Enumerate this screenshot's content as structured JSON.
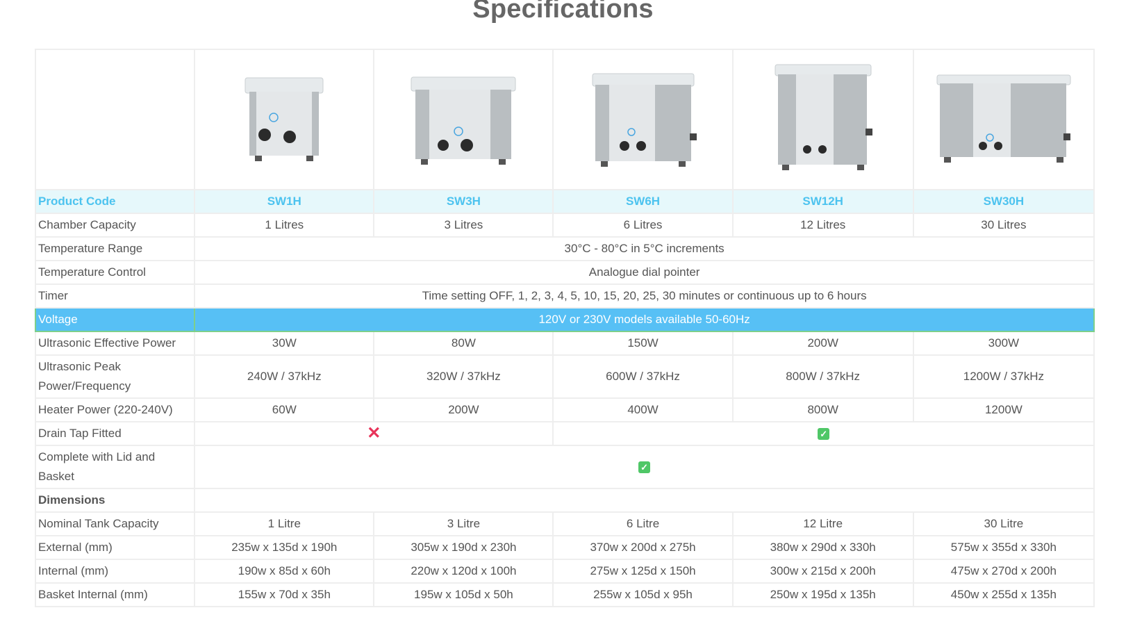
{
  "title": "Specifications",
  "products": [
    {
      "code": "SW1H",
      "capacity": "1 Litres",
      "effective_power": "30W",
      "peak_power": "240W / 37kHz",
      "heater_power": "60W",
      "nominal": "1 Litre",
      "external": "235w x 135d x 190h",
      "internal": "190w x 85d x 60h",
      "basket": "155w x 70d x 35h"
    },
    {
      "code": "SW3H",
      "capacity": "3 Litres",
      "effective_power": "80W",
      "peak_power": "320W / 37kHz",
      "heater_power": "200W",
      "nominal": "3 Litre",
      "external": "305w x 190d x 230h",
      "internal": "220w x 120d x 100h",
      "basket": "195w x 105d x 50h"
    },
    {
      "code": "SW6H",
      "capacity": "6 Litres",
      "effective_power": "150W",
      "peak_power": "600W / 37kHz",
      "heater_power": "400W",
      "nominal": "6 Litre",
      "external": "370w x 200d x 275h",
      "internal": "275w x 125d x 150h",
      "basket": "255w x 105d x 95h"
    },
    {
      "code": "SW12H",
      "capacity": "12 Litres",
      "effective_power": "200W",
      "peak_power": "800W / 37kHz",
      "heater_power": "800W",
      "nominal": "12 Litre",
      "external": "380w x 290d x 330h",
      "internal": "300w x 215d x 200h",
      "basket": "250w x 195d x 135h"
    },
    {
      "code": "SW30H",
      "capacity": "30 Litres",
      "effective_power": "300W",
      "peak_power": "1200W / 37kHz",
      "heater_power": "1200W",
      "nominal": "30 Litre",
      "external": "575w x 355d x 330h",
      "internal": "475w x 270d x 200h",
      "basket": "450w x 255d x 135h"
    }
  ],
  "labels": {
    "product_code": "Product Code",
    "chamber_capacity": "Chamber Capacity",
    "temperature_range": "Temperature Range",
    "temperature_control": "Temperature Control",
    "timer": "Timer",
    "voltage": "Voltage",
    "effective_power": "Ultrasonic Effective Power",
    "peak_power": "Ultrasonic Peak Power/Frequency",
    "heater_power": "Heater Power (220-240V)",
    "drain_tap": "Drain Tap Fitted",
    "lid_basket": "Complete with Lid and Basket",
    "dimensions": "Dimensions",
    "nominal": "Nominal Tank Capacity",
    "external": "External (mm)",
    "internal": "Internal (mm)",
    "basket": "Basket Internal (mm)"
  },
  "shared": {
    "temperature_range": "30°C - 80°C in 5°C increments",
    "temperature_control": "Analogue dial pointer",
    "timer": "Time setting OFF, 1, 2, 3, 4, 5, 10, 15, 20, 25, 30 minutes or continuous up to 6 hours",
    "voltage": "120V or 230V models available 50-60Hz"
  },
  "availability": {
    "drain_tap_small_models": "no",
    "drain_tap_large_models": "yes",
    "lid_basket_all": "yes"
  },
  "icons": {
    "cross": "cross-icon",
    "check": "check-icon"
  },
  "colors": {
    "code_text": "#4cc3ef",
    "code_bg": "#e6f8fb",
    "voltage_bg": "#57c0f5",
    "cross": "#e8345a",
    "check": "#4fc767"
  }
}
